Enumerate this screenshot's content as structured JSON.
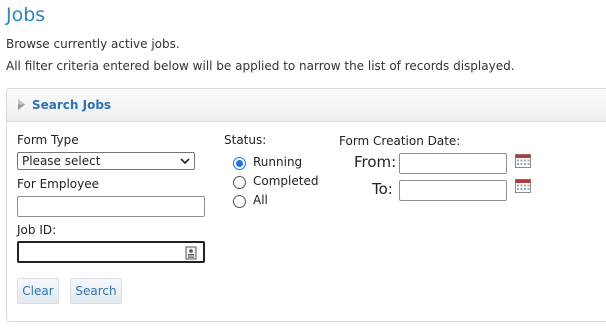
{
  "page": {
    "title": "Jobs",
    "desc1": "Browse currently active jobs.",
    "desc2": "All filter criteria entered below will be applied to narrow the list of records displayed."
  },
  "panel": {
    "title": "Search Jobs",
    "form_type_label": "Form Type",
    "form_type_value": "Please select",
    "employee_label": "For Employee",
    "employee_value": "",
    "job_id_label": "Job ID:",
    "job_id_value": "",
    "clear_label": "Clear",
    "search_label": "Search",
    "status_label": "Status:",
    "status_options": [
      "Running",
      "Completed",
      "All"
    ],
    "status_selected": "Running",
    "date_label": "Form Creation Date:",
    "from_label": "From:",
    "to_label": "To:",
    "from_value": "",
    "to_value": ""
  },
  "icons": {
    "header_arrow": "triangle-right-icon",
    "job_id_field": "id-card-icon",
    "date_picker": "calendar-icon"
  },
  "colors": {
    "title": "#2a86c6",
    "link": "#2a73b4",
    "radio_selected": "#1a73e8"
  }
}
